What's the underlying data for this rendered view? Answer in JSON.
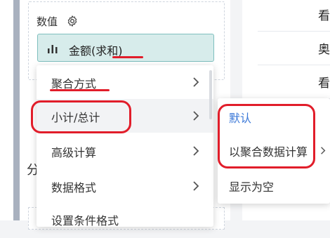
{
  "panel": {
    "section_title": "数值",
    "field_label": "金额(求和)"
  },
  "menu": {
    "items": [
      {
        "label": "聚合方式"
      },
      {
        "label": "小计/总计"
      },
      {
        "label": "高级计算"
      },
      {
        "label": "数据格式"
      },
      {
        "label": "设置条件格式"
      }
    ]
  },
  "submenu": {
    "items": [
      {
        "label": "默认",
        "active": true
      },
      {
        "label": "以聚合数据计算"
      },
      {
        "label": "显示为空"
      }
    ]
  },
  "right_column": {
    "cells": [
      "看",
      "奥",
      "看"
    ]
  },
  "partial_text": {
    "left_char": "分"
  },
  "colors": {
    "accent": "#3b78d8",
    "annotation": "#e11d2a",
    "pill_bg": "#d7eceb",
    "pill_border": "#7fbfbe"
  }
}
